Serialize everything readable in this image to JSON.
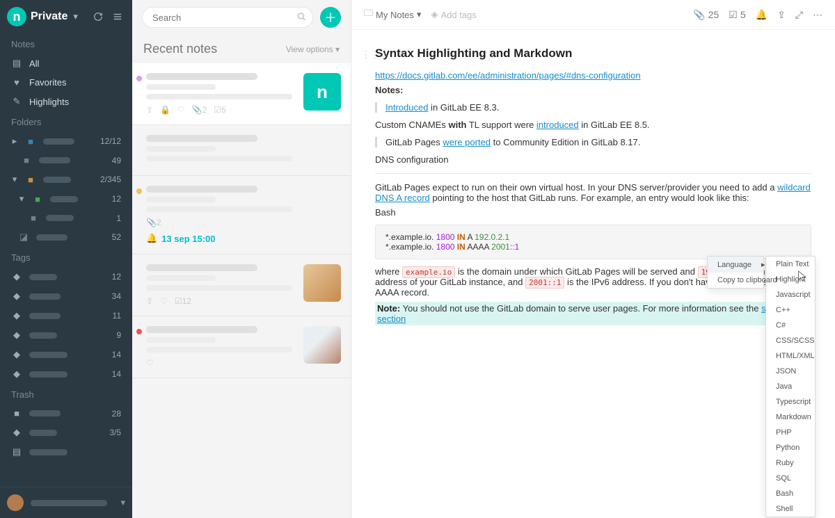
{
  "header": {
    "workspace": "Private"
  },
  "sidebar": {
    "sections": {
      "notes": {
        "title": "Notes",
        "all": "All",
        "fav": "Favorites",
        "hl": "Highlights"
      },
      "folders": {
        "title": "Folders",
        "items": [
          {
            "count": "12/12"
          },
          {
            "count": "49"
          },
          {
            "count": "2/345"
          },
          {
            "count": "12"
          },
          {
            "count": "1"
          },
          {
            "count": "52"
          }
        ]
      },
      "tags": {
        "title": "Tags",
        "items": [
          {
            "count": "12"
          },
          {
            "count": "34"
          },
          {
            "count": "11"
          },
          {
            "count": "9"
          },
          {
            "count": "14"
          },
          {
            "count": "14"
          }
        ]
      },
      "trash": {
        "title": "Trash",
        "items": [
          {
            "count": "28"
          },
          {
            "count": "3/5"
          },
          {
            "count": ""
          }
        ]
      }
    }
  },
  "mid": {
    "search_ph": "Search",
    "title": "Recent notes",
    "view_opts": "View options",
    "reminder": "13 sep 15:00",
    "attach2": "2",
    "attach1": "2",
    "todo1": "5",
    "todo2": "12"
  },
  "top": {
    "crumb": "My Notes",
    "tags_ph": "Add tags",
    "clip": "25",
    "todo": "5"
  },
  "doc": {
    "title": "Syntax Highlighting and Markdown",
    "link1": "https://docs.gitlab.com/ee/administration/pages/#dns-configuration",
    "notes": "Notes:",
    "intro_link": "Introduced",
    "intro_tail": " in GitLab EE 8.3.",
    "p_cnames1": "Custom   CNAMEs ",
    "p_cnames_with": "with",
    "p_cnames2": "  TL support were ",
    "p_cnames_link": "introduced",
    "p_cnames3": " in GitLab EE 8.5.",
    "ported1": "GitLab Pages ",
    "ported_link": "were ported",
    "ported2": " to Community Edition in GitLab 8.17.",
    "dns_head": "DNS configuration",
    "p_expect1": "GitLab Pages expect to run  on  their own virtual host. In your DNS server/provider you need to add a ",
    "p_expect_link": "wildcard DNS A record",
    "p_expect2": " pointing to the host that GitLab runs. For example, an entry would look like this:",
    "bash": "Bash",
    "code": {
      "prefix": "*.example.io.",
      "ttl": "1800",
      "in": "IN",
      "a": "A",
      "aaaa": "AAAA",
      "ip4": "192.0.2.1",
      "ip6_a": "2001",
      "ip6_b": "::1"
    },
    "where1": "where ",
    "where_code1": "example.io",
    "where2": " is the domain under which GitLab Pages will be served and ",
    "where_code2": "192.0.2.1",
    "where3": " is the IPv4 address of your GitLab instance, and ",
    "where_code3": "2001::1",
    "where4": " is the IPv6 address. If you don't have IPv6, you can omit the AAAA record.",
    "note_b": "Note:",
    "note_t": " You should not use the GitLab domain to serve user pages. For more information see the ",
    "note_link": "security section"
  },
  "ctx": {
    "menu2": [
      "Language",
      "Copy to clipboard"
    ],
    "menu1": [
      "Plain Text",
      "Highlight",
      "Javascript",
      "C++",
      "C#",
      "CSS/SCSS",
      "HTML/XML",
      "JSON",
      "Java",
      "Typescript",
      "Markdown",
      "PHP",
      "Python",
      "Ruby",
      "SQL",
      "Bash",
      "Shell"
    ]
  }
}
